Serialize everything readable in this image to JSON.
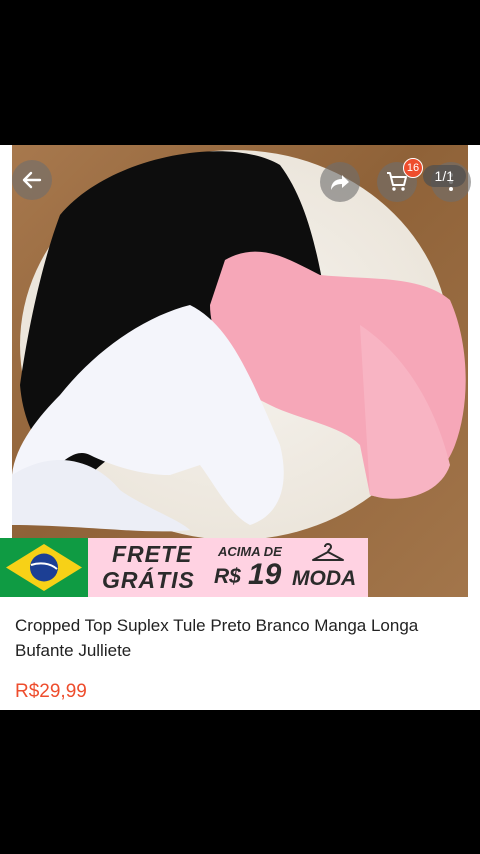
{
  "product": {
    "title": "Cropped  Top Suplex Tule Preto Branco Manga Longa Bufante Julliete",
    "price": "R$29,99"
  },
  "gallery": {
    "counter": "1/1"
  },
  "header": {
    "cart_count": "16"
  },
  "banner": {
    "frete": "FRETE",
    "gratis": "GRÁTIS",
    "acima": "ACIMA DE",
    "currency": "R$",
    "amount": "19",
    "moda": "MODA"
  },
  "icons": [
    "back-arrow-icon",
    "share-icon",
    "cart-icon",
    "more-vertical-icon",
    "brazil-flag-icon",
    "hanger-icon"
  ],
  "colors": {
    "accent": "#ee4d2d",
    "banner_pink": "#ffd2e2",
    "flag_green": "#0f9b43"
  }
}
